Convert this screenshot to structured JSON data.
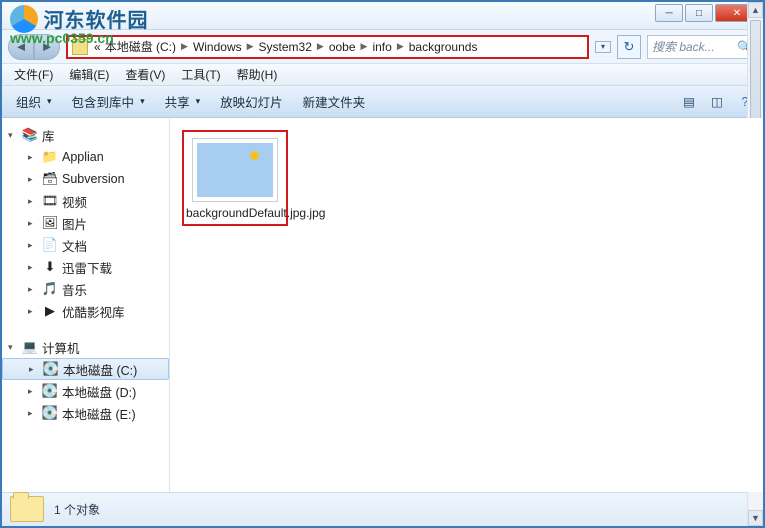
{
  "watermark": {
    "site": "河东软件园",
    "url": "www.pc0359.cn"
  },
  "breadcrumb": {
    "prefix": "«",
    "segs": [
      "本地磁盘 (C:)",
      "Windows",
      "System32",
      "oobe",
      "info",
      "backgrounds"
    ]
  },
  "search": {
    "placeholder": "搜索 back..."
  },
  "menu": {
    "file": "文件(F)",
    "edit": "编辑(E)",
    "view": "查看(V)",
    "tools": "工具(T)",
    "help": "帮助(H)"
  },
  "toolbar": {
    "organize": "组织",
    "include": "包含到库中",
    "share": "共享",
    "slideshow": "放映幻灯片",
    "newfolder": "新建文件夹"
  },
  "sidebar": {
    "libraries": "库",
    "items": [
      {
        "label": "Applian"
      },
      {
        "label": "Subversion"
      },
      {
        "label": "视频"
      },
      {
        "label": "图片"
      },
      {
        "label": "文档"
      },
      {
        "label": "迅雷下载"
      },
      {
        "label": "音乐"
      },
      {
        "label": "优酷影视库"
      }
    ],
    "computer": "计算机",
    "drives": [
      {
        "label": "本地磁盘 (C:)"
      },
      {
        "label": "本地磁盘 (D:)"
      },
      {
        "label": "本地磁盘 (E:)"
      }
    ]
  },
  "files": [
    {
      "name": "backgroundDefault.jpg.jpg"
    }
  ],
  "status": {
    "count": "1 个对象"
  }
}
